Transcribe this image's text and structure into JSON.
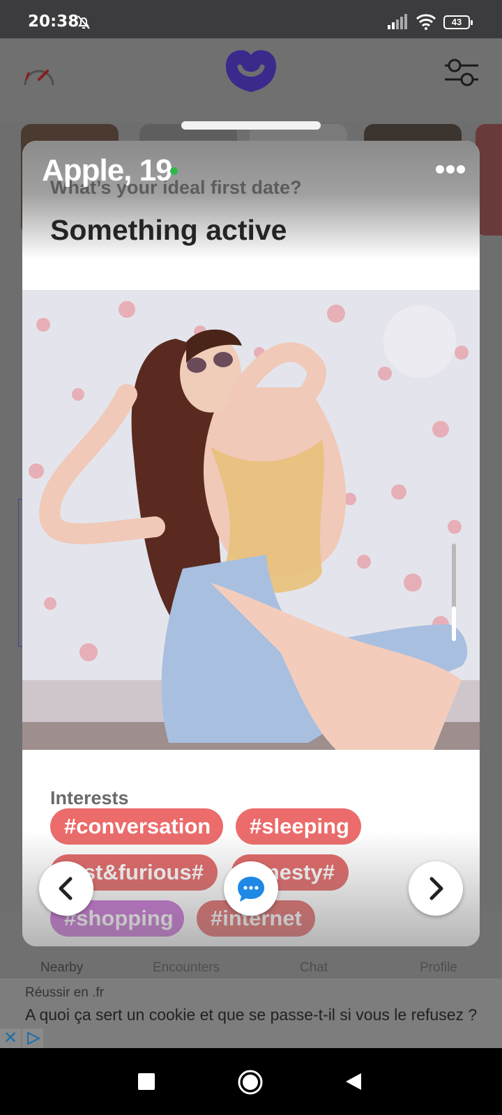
{
  "status_bar": {
    "time": "20:38",
    "battery": "43"
  },
  "profile_card": {
    "name": "Apple, 19",
    "question": "What’s your ideal first date?",
    "answer": "Something active",
    "interests_title": "Interests",
    "interests": [
      "#conversation",
      "#sleeping",
      "#fast&furious",
      "#honesty",
      "#shopping",
      "#internet"
    ]
  },
  "tabs": {
    "nearby": "Nearby",
    "encounters": "Encounters",
    "chat": "Chat",
    "profile": "Profile"
  },
  "ad": {
    "source": "Réussir en .fr",
    "text": "A quoi ça sert un cookie et que se passe-t-il si vous le refusez ?"
  },
  "colors": {
    "brand": "#5b3cc4",
    "chip": "#ec6b6b",
    "chip_purple": "#c86bd6",
    "chat_blue": "#1e88e5",
    "online": "#2db84a"
  }
}
